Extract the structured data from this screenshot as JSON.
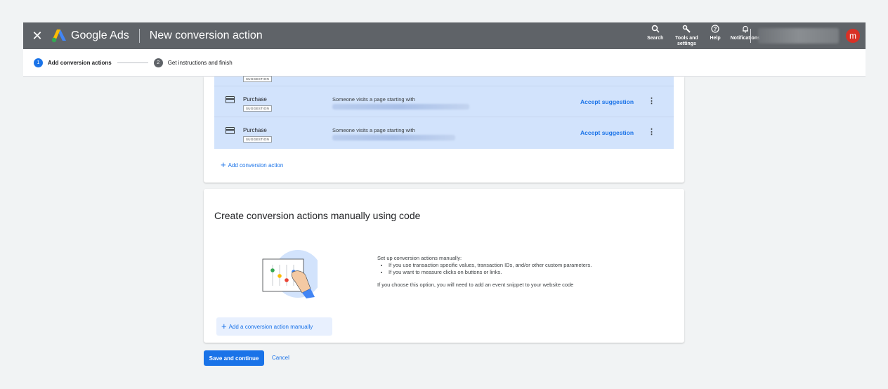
{
  "header": {
    "close_icon": "close-icon",
    "brand": "Google Ads",
    "page_title": "New conversion action",
    "tools": [
      {
        "icon": "search-icon",
        "label": "Search"
      },
      {
        "icon": "wrench-icon",
        "label": "Tools and settings"
      },
      {
        "icon": "help-icon",
        "label": "Help"
      },
      {
        "icon": "bell-icon",
        "label": "Notifications"
      }
    ],
    "avatar_letter": "m"
  },
  "stepper": {
    "steps": [
      {
        "num": "1",
        "label": "Add conversion actions"
      },
      {
        "num": "2",
        "label": "Get instructions and finish"
      }
    ]
  },
  "suggestions": {
    "badge": "SUGGESTION",
    "rows": [
      {
        "name": "Purchase",
        "badge": "SUGGESTION",
        "rule": "Someone visits a page starting with",
        "action": "Accept suggestion"
      },
      {
        "name": "Purchase",
        "badge": "SUGGESTION",
        "rule": "Someone visits a page starting with",
        "action": "Accept suggestion"
      }
    ],
    "add_label": "Add conversion action"
  },
  "manual": {
    "title": "Create conversion actions manually using code",
    "intro": "Set up conversion actions manually:",
    "bullets": [
      "If you use transaction specific values, transaction IDs, and/or other custom parameters.",
      "If you want to measure clicks on buttons or links."
    ],
    "note": "If you choose this option, you will need to add an event snippet to your website code",
    "button": "Add a conversion action manually"
  },
  "footer": {
    "save": "Save and continue",
    "cancel": "Cancel"
  },
  "colors": {
    "accent": "#1a73e8",
    "topbar": "#5f6368",
    "suggestion_bg": "#d2e3fc",
    "avatar": "#d93025"
  }
}
